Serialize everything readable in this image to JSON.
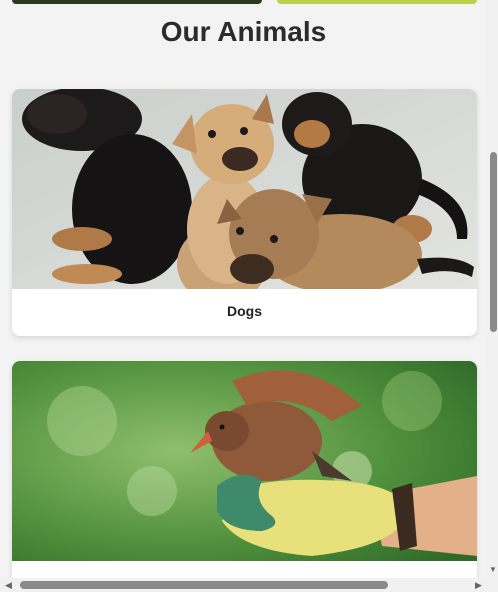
{
  "page": {
    "title": "Our Animals"
  },
  "cards": [
    {
      "label": "Dogs",
      "image": "puppies-photo"
    },
    {
      "label": "",
      "image": "bird-on-gloved-hand-photo"
    }
  ],
  "scrollbars": {
    "arrow_down": "▼",
    "arrow_left": "◀",
    "arrow_right": "▶"
  },
  "colors": {
    "background": "#f3f3f3",
    "card": "#ffffff",
    "title": "#2b2b2b"
  }
}
